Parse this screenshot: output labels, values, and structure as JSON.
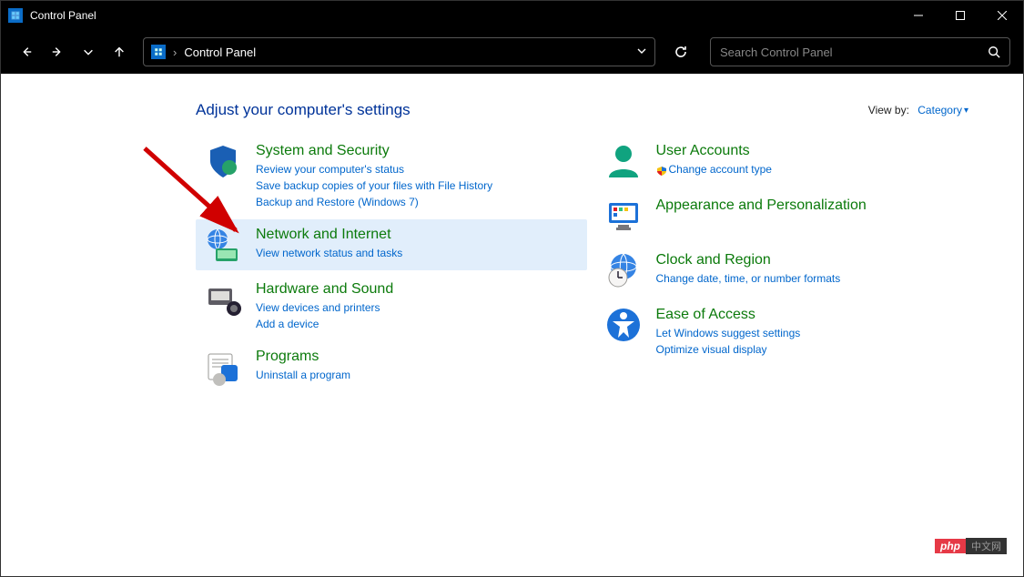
{
  "window": {
    "title": "Control Panel"
  },
  "address": {
    "location": "Control Panel"
  },
  "search": {
    "placeholder": "Search Control Panel"
  },
  "heading": "Adjust your computer's settings",
  "viewby": {
    "label": "View by:",
    "value": "Category"
  },
  "left": [
    {
      "id": "system-security",
      "title": "System and Security",
      "subs": [
        "Review your computer's status",
        "Save backup copies of your files with File History",
        "Backup and Restore (Windows 7)"
      ],
      "highlighted": false
    },
    {
      "id": "network-internet",
      "title": "Network and Internet",
      "subs": [
        "View network status and tasks"
      ],
      "highlighted": true
    },
    {
      "id": "hardware-sound",
      "title": "Hardware and Sound",
      "subs": [
        "View devices and printers",
        "Add a device"
      ],
      "highlighted": false
    },
    {
      "id": "programs",
      "title": "Programs",
      "subs": [
        "Uninstall a program"
      ],
      "highlighted": false
    }
  ],
  "right": [
    {
      "id": "user-accounts",
      "title": "User Accounts",
      "subs": [
        "Change account type"
      ],
      "shield_on": [
        0
      ],
      "highlighted": false
    },
    {
      "id": "appearance",
      "title": "Appearance and Personalization",
      "subs": [],
      "highlighted": false
    },
    {
      "id": "clock-region",
      "title": "Clock and Region",
      "subs": [
        "Change date, time, or number formats"
      ],
      "highlighted": false
    },
    {
      "id": "ease-of-access",
      "title": "Ease of Access",
      "subs": [
        "Let Windows suggest settings",
        "Optimize visual display"
      ],
      "highlighted": false
    }
  ],
  "watermark": {
    "a": "php",
    "b": "中文网"
  }
}
